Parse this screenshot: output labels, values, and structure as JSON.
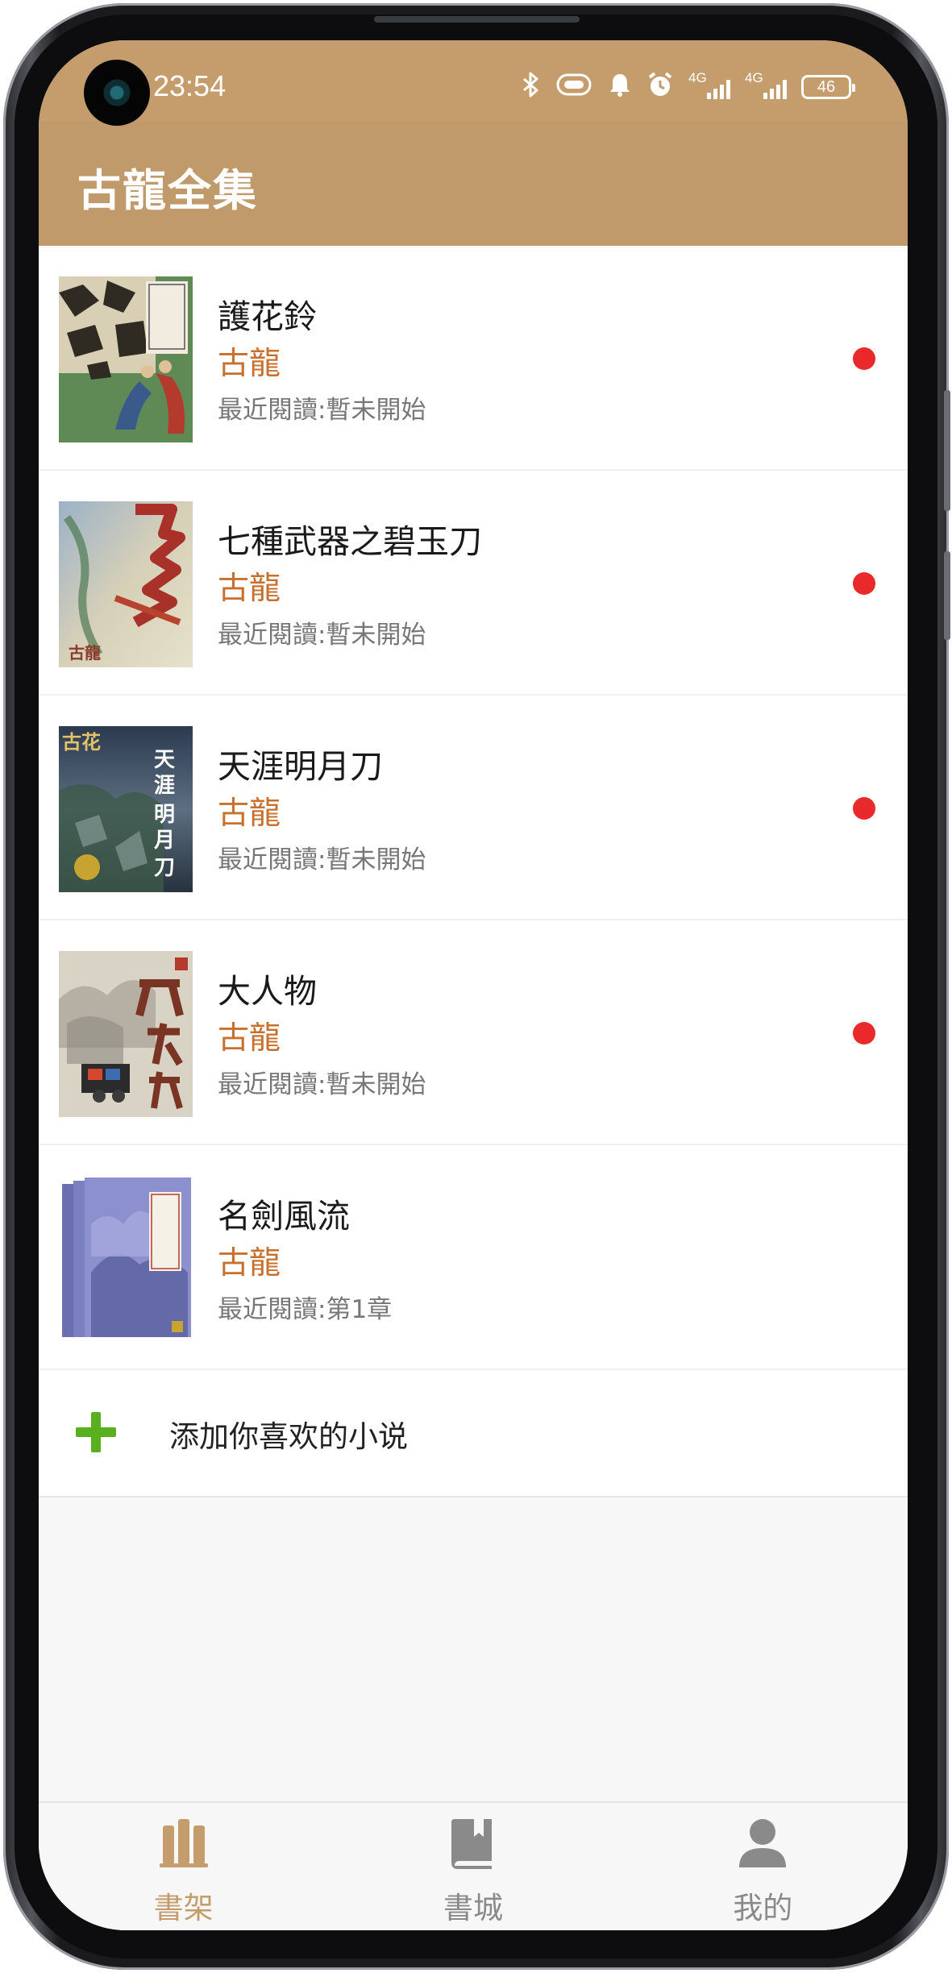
{
  "status_bar": {
    "time": "23:54",
    "signal1_label": "4G",
    "signal2_label": "4G",
    "battery": "46"
  },
  "app_bar": {
    "title": "古龍全集"
  },
  "books": [
    {
      "title": "護花鈴",
      "author": "古龍",
      "last_read": "最近閱讀:暫未開始",
      "unread_dot": true
    },
    {
      "title": "七種武器之碧玉刀",
      "author": "古龍",
      "last_read": "最近閱讀:暫未開始",
      "unread_dot": true
    },
    {
      "title": "天涯明月刀",
      "author": "古龍",
      "last_read": "最近閱讀:暫未開始",
      "unread_dot": true
    },
    {
      "title": "大人物",
      "author": "古龍",
      "last_read": "最近閱讀:暫未開始",
      "unread_dot": true
    },
    {
      "title": "名劍風流",
      "author": "古龍",
      "last_read": "最近閱讀:第1章",
      "unread_dot": false
    }
  ],
  "add_row": {
    "label": "添加你喜欢的小说",
    "icon": "plus-icon"
  },
  "nav": [
    {
      "label": "書架",
      "icon": "bookshelf-icon",
      "active": true
    },
    {
      "label": "書城",
      "icon": "book-icon",
      "active": false
    },
    {
      "label": "我的",
      "icon": "person-icon",
      "active": false
    }
  ],
  "colors": {
    "brand": "#c09a6b",
    "author_text": "#c8702e",
    "unread_dot": "#ea2a2a",
    "add_icon": "#58b01f",
    "nav_active": "#c59d6d",
    "nav_inactive": "#8a8a8a"
  }
}
